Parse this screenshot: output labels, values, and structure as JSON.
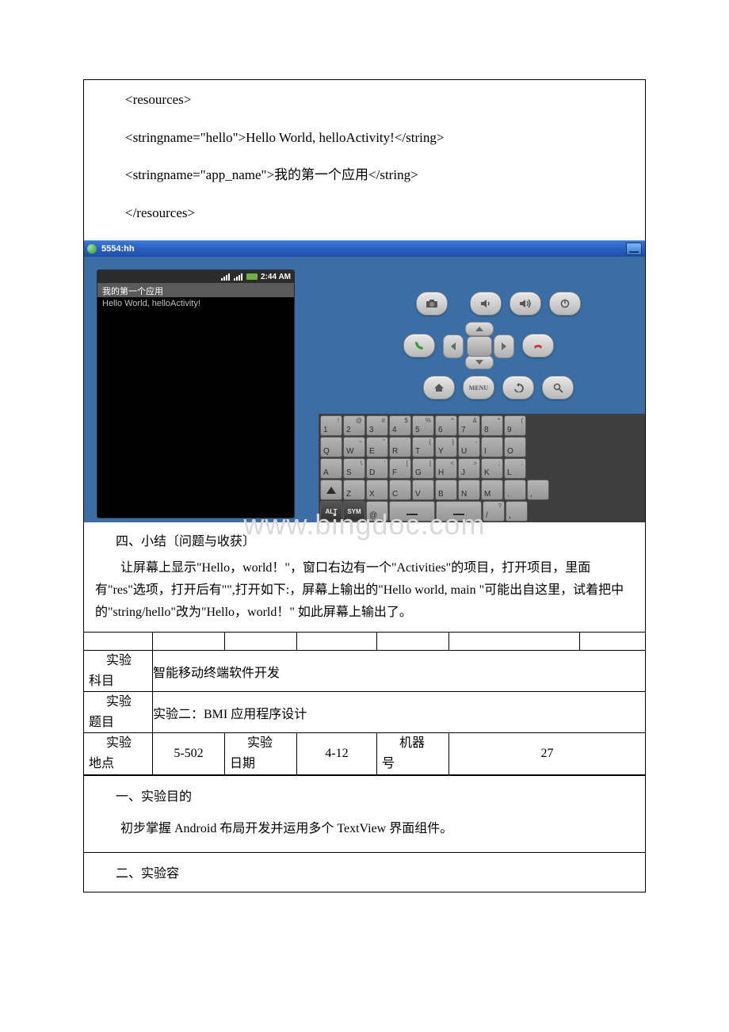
{
  "code": {
    "line1": "<resources>",
    "line2": "<stringname=\"hello\">Hello World, helloActivity!</string>",
    "line3": "<stringname=\"app_name\">我的第一个应用</string>",
    "line4": "</resources>"
  },
  "emulator": {
    "title": "5554:hh",
    "status_time": "2:44 AM",
    "app_title": "我的第一个应用",
    "app_content": "Hello World, helloActivity!",
    "buttons": {
      "camera": "camera",
      "vol_down": "volume-down",
      "vol_up": "volume-up",
      "power": "power",
      "call": "call",
      "end": "end-call",
      "home": "home",
      "menu": "MENU",
      "back": "back",
      "search": "search"
    },
    "keyboard": {
      "row1": [
        {
          "k": "1",
          "s": "!"
        },
        {
          "k": "2",
          "s": "@"
        },
        {
          "k": "3",
          "s": "#"
        },
        {
          "k": "4",
          "s": "$"
        },
        {
          "k": "5",
          "s": "%"
        },
        {
          "k": "6",
          "s": "^"
        },
        {
          "k": "7",
          "s": "&"
        },
        {
          "k": "8",
          "s": "*"
        },
        {
          "k": "9",
          "s": "("
        }
      ],
      "row2": [
        {
          "k": "Q",
          "s": ""
        },
        {
          "k": "W",
          "s": "~"
        },
        {
          "k": "E",
          "s": "\""
        },
        {
          "k": "R",
          "s": "`"
        },
        {
          "k": "T",
          "s": "{"
        },
        {
          "k": "Y",
          "s": "}"
        },
        {
          "k": "U",
          "s": "-"
        },
        {
          "k": "I",
          "s": ""
        },
        {
          "k": "O",
          "s": ""
        }
      ],
      "row3": [
        {
          "k": "A",
          "s": ""
        },
        {
          "k": "S",
          "s": "\\"
        },
        {
          "k": "D",
          "s": "'"
        },
        {
          "k": "F",
          "s": "["
        },
        {
          "k": "G",
          "s": "]"
        },
        {
          "k": "H",
          "s": "<"
        },
        {
          "k": "J",
          "s": ">"
        },
        {
          "k": "K",
          "s": ";"
        },
        {
          "k": "L",
          "s": ":"
        }
      ],
      "row4": [
        {
          "k": "shift"
        },
        {
          "k": "Z",
          "s": ""
        },
        {
          "k": "X",
          "s": ""
        },
        {
          "k": "C",
          "s": ""
        },
        {
          "k": "V",
          "s": ""
        },
        {
          "k": "B",
          "s": ""
        },
        {
          "k": "N",
          "s": ""
        },
        {
          "k": "M",
          "s": ""
        },
        {
          "k": ".",
          "s": ""
        },
        {
          "k": ",",
          "s": ""
        }
      ],
      "row5": [
        {
          "k": "ALT",
          "dark": true
        },
        {
          "k": "SYM",
          "dark": true
        },
        {
          "k": "@",
          "s": ""
        },
        {
          "k": "space",
          "wide": true
        },
        {
          "k": "space2",
          "wide": true
        },
        {
          "k": "/",
          "s": "?"
        },
        {
          "k": ",",
          "s": ""
        }
      ]
    }
  },
  "watermark": "www.bingdoc.com",
  "summary": {
    "heading": "四、小结〔问题与收获〕",
    "body": "让屏幕上显示\"Hello，world！\"，窗口右边有一个\"Activities\"的项目，打开项目，里面有\"res\"选项，打开后有\"\",打开如下:，屏幕上输出的\"Hello world, main \"可能出自这里，试着把中的\"string/hello\"改为\"Hello，world！\" 如此屏幕上输出了。"
  },
  "info": {
    "subject_label_1": "实验",
    "subject_label_2": "科目",
    "subject_value": "智能移动终端软件开发",
    "title_label_1": "实验",
    "title_label_2": "题目",
    "title_value": "实验二：BMI 应用程序设计",
    "loc_label_1": "实验",
    "loc_label_2": "地点",
    "loc_value": "5-502",
    "date_label_1": "实验",
    "date_label_2": "日期",
    "date_value": "4-12",
    "machine_label_1": "机器",
    "machine_label_2": "号",
    "machine_value": "27"
  },
  "section1": {
    "heading": "一、实验目的",
    "body": "初步掌握 Android 布局开发并运用多个 TextView 界面组件。"
  },
  "section2": {
    "heading": "二、实验容"
  }
}
